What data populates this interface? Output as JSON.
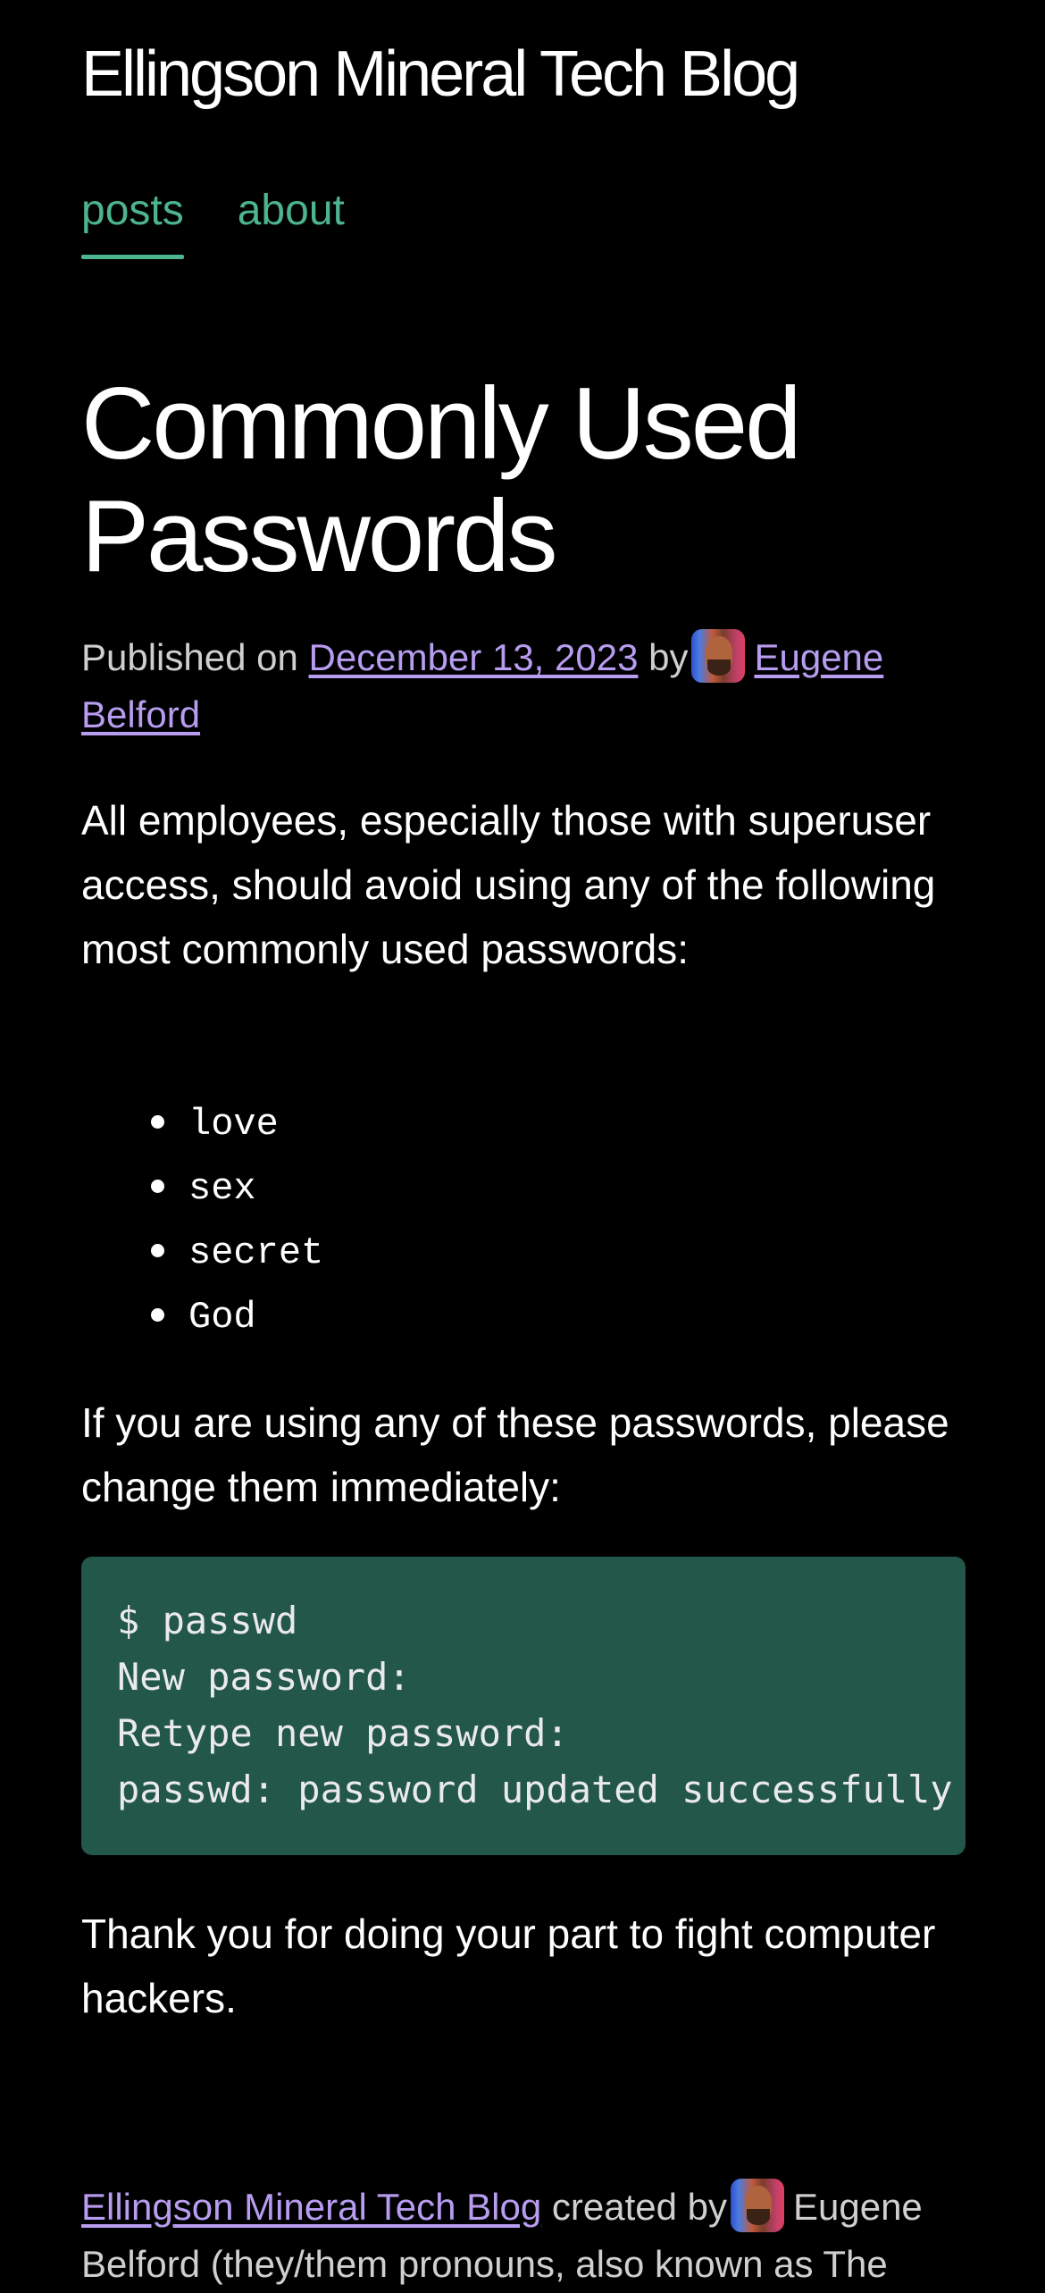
{
  "site": {
    "title": "Ellingson Mineral Tech Blog"
  },
  "nav": {
    "items": [
      {
        "label": "posts",
        "active": true
      },
      {
        "label": "about",
        "active": false
      }
    ]
  },
  "post": {
    "title": "Commonly Used Passwords",
    "meta": {
      "published_prefix": "Published on",
      "date": "December 13, 2023",
      "by": "by",
      "author": "Eugene Belford"
    },
    "intro": "All employees, especially those with superuser access, should avoid using any of the following most commonly used passwords:",
    "passwords": [
      "love",
      "sex",
      "secret",
      "God"
    ],
    "change_prompt": "If you are using any of these passwords, please change them immediately:",
    "code_lines": [
      "$ passwd",
      "New password:",
      "Retype new password:",
      "passwd: password updated successfully"
    ],
    "closing": "Thank you for doing your part to fight computer hackers."
  },
  "footer": {
    "site_link": "Ellingson Mineral Tech Blog",
    "created_by": "created by",
    "author_text": "Eugene Belford (they/them pronouns, also known as The"
  },
  "colors": {
    "background": "#000000",
    "nav_accent": "#4db58e",
    "link": "#b79cf0",
    "code_background": "#22574a"
  },
  "icons": {
    "author_avatar": "author-avatar-photo"
  }
}
